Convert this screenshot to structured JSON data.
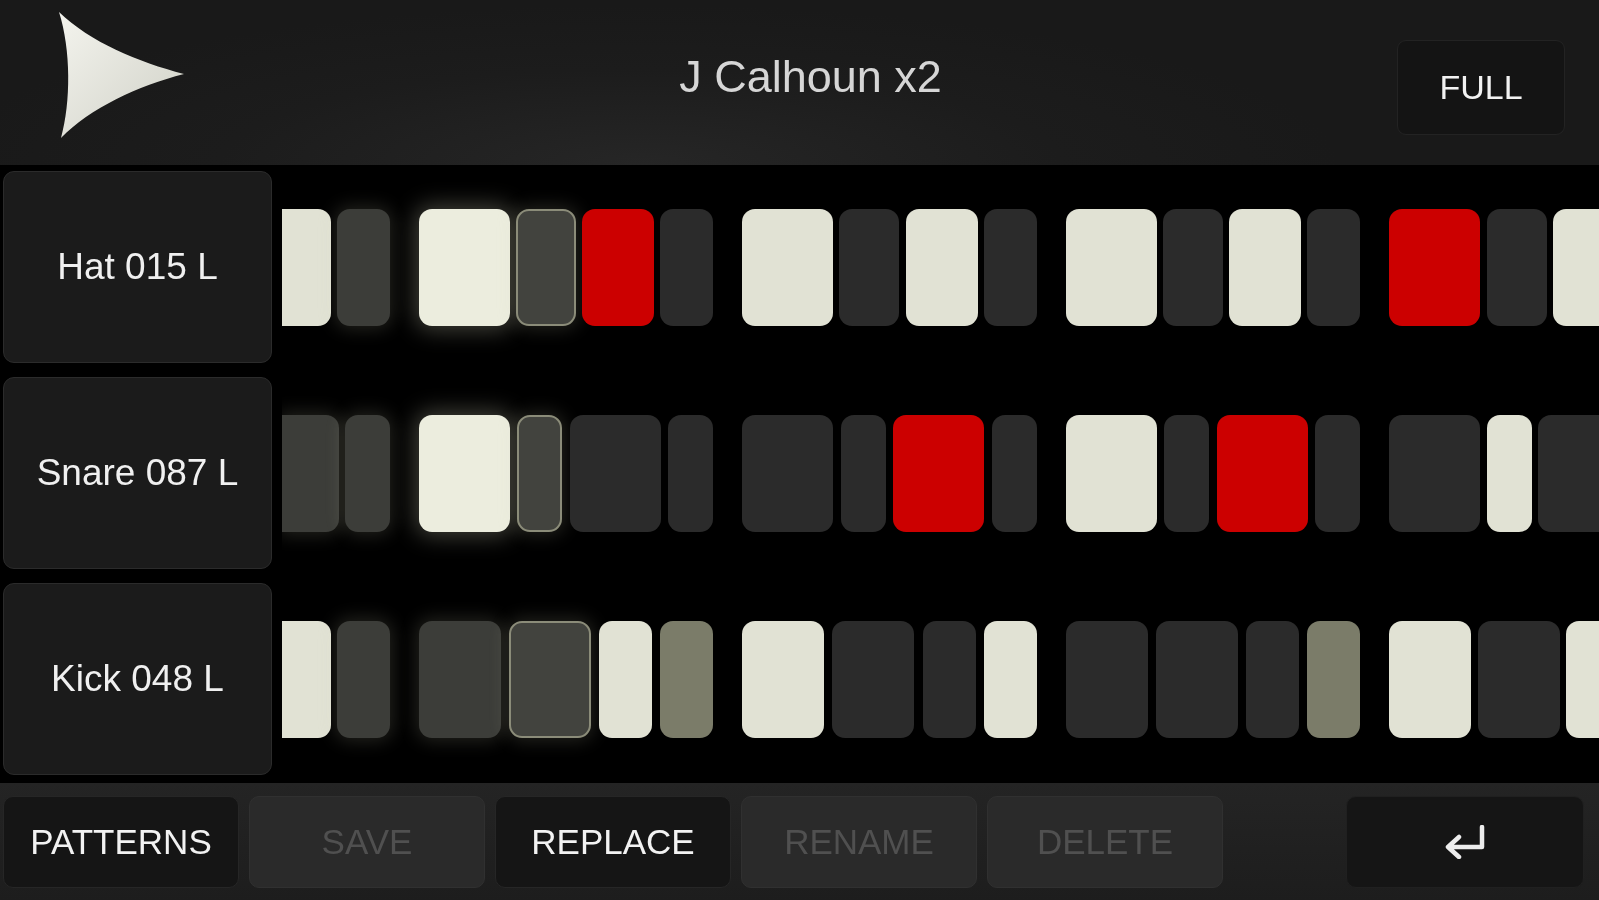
{
  "header": {
    "title": "J Calhoun x2",
    "view_button": "FULL"
  },
  "tracks": [
    {
      "name": "Hat 015 L",
      "kind": "mixed",
      "groups": [
        [
          {
            "kind": "on",
            "lit": false,
            "selected": false
          },
          {
            "kind": "off",
            "lit": true,
            "selected": false
          }
        ],
        [
          {
            "kind": "on",
            "lit": true,
            "selected": false
          },
          {
            "kind": "off",
            "lit": true,
            "selected": true
          },
          {
            "kind": "accent",
            "lit": false,
            "selected": false
          },
          {
            "kind": "off",
            "lit": false,
            "selected": false
          }
        ],
        [
          {
            "kind": "on",
            "lit": false,
            "selected": false
          },
          {
            "kind": "off",
            "lit": false,
            "selected": false
          },
          {
            "kind": "on",
            "lit": false,
            "selected": false
          },
          {
            "kind": "off",
            "lit": false,
            "selected": false
          }
        ],
        [
          {
            "kind": "on",
            "lit": false,
            "selected": false
          },
          {
            "kind": "off",
            "lit": false,
            "selected": false
          },
          {
            "kind": "on",
            "lit": false,
            "selected": false
          },
          {
            "kind": "off",
            "lit": false,
            "selected": false
          }
        ],
        [
          {
            "kind": "accent",
            "lit": false,
            "selected": false
          },
          {
            "kind": "off",
            "lit": false,
            "selected": false
          },
          {
            "kind": "on",
            "lit": false,
            "selected": false
          }
        ]
      ]
    },
    {
      "name": "Snare 087 L",
      "kind": "alternating",
      "groups": [
        [
          {
            "kind": "off",
            "lit": true,
            "selected": false
          },
          {
            "kind": "off",
            "lit": true,
            "selected": false
          }
        ],
        [
          {
            "kind": "on",
            "lit": true,
            "selected": false
          },
          {
            "kind": "off",
            "lit": true,
            "selected": true
          },
          {
            "kind": "off",
            "lit": false,
            "selected": false
          },
          {
            "kind": "off",
            "lit": false,
            "selected": false
          }
        ],
        [
          {
            "kind": "off",
            "lit": false,
            "selected": false
          },
          {
            "kind": "off",
            "lit": false,
            "selected": false
          },
          {
            "kind": "accent",
            "lit": false,
            "selected": false
          },
          {
            "kind": "off",
            "lit": false,
            "selected": false
          }
        ],
        [
          {
            "kind": "on",
            "lit": false,
            "selected": false
          },
          {
            "kind": "off",
            "lit": false,
            "selected": false
          },
          {
            "kind": "accent",
            "lit": false,
            "selected": false
          },
          {
            "kind": "off",
            "lit": false,
            "selected": false
          }
        ],
        [
          {
            "kind": "off",
            "lit": false,
            "selected": false
          },
          {
            "kind": "on",
            "lit": false,
            "selected": false
          },
          {
            "kind": "off",
            "lit": false,
            "selected": false
          }
        ]
      ]
    },
    {
      "name": "Kick 048 L",
      "kind": "paired",
      "groups": [
        [
          {
            "kind": "on",
            "lit": false,
            "selected": false
          },
          {
            "kind": "off",
            "lit": true,
            "selected": false
          }
        ],
        [
          {
            "kind": "off",
            "lit": true,
            "selected": false
          },
          {
            "kind": "off",
            "lit": true,
            "selected": true
          },
          {
            "kind": "on",
            "lit": false,
            "selected": false
          },
          {
            "kind": "soft",
            "lit": false,
            "selected": false
          }
        ],
        [
          {
            "kind": "on",
            "lit": false,
            "selected": false
          },
          {
            "kind": "off",
            "lit": false,
            "selected": false
          },
          {
            "kind": "off",
            "lit": false,
            "selected": false
          },
          {
            "kind": "on",
            "lit": false,
            "selected": false
          }
        ],
        [
          {
            "kind": "off",
            "lit": false,
            "selected": false
          },
          {
            "kind": "off",
            "lit": false,
            "selected": false
          },
          {
            "kind": "off",
            "lit": false,
            "selected": false
          },
          {
            "kind": "soft",
            "lit": false,
            "selected": false
          }
        ],
        [
          {
            "kind": "on",
            "lit": false,
            "selected": false
          },
          {
            "kind": "off",
            "lit": false,
            "selected": false
          },
          {
            "kind": "on",
            "lit": false,
            "selected": false
          }
        ]
      ]
    }
  ],
  "footer": {
    "buttons": [
      {
        "label": "PATTERNS",
        "disabled": false
      },
      {
        "label": "SAVE",
        "disabled": true
      },
      {
        "label": "REPLACE",
        "disabled": false
      },
      {
        "label": "RENAME",
        "disabled": true
      },
      {
        "label": "DELETE",
        "disabled": true
      }
    ]
  }
}
